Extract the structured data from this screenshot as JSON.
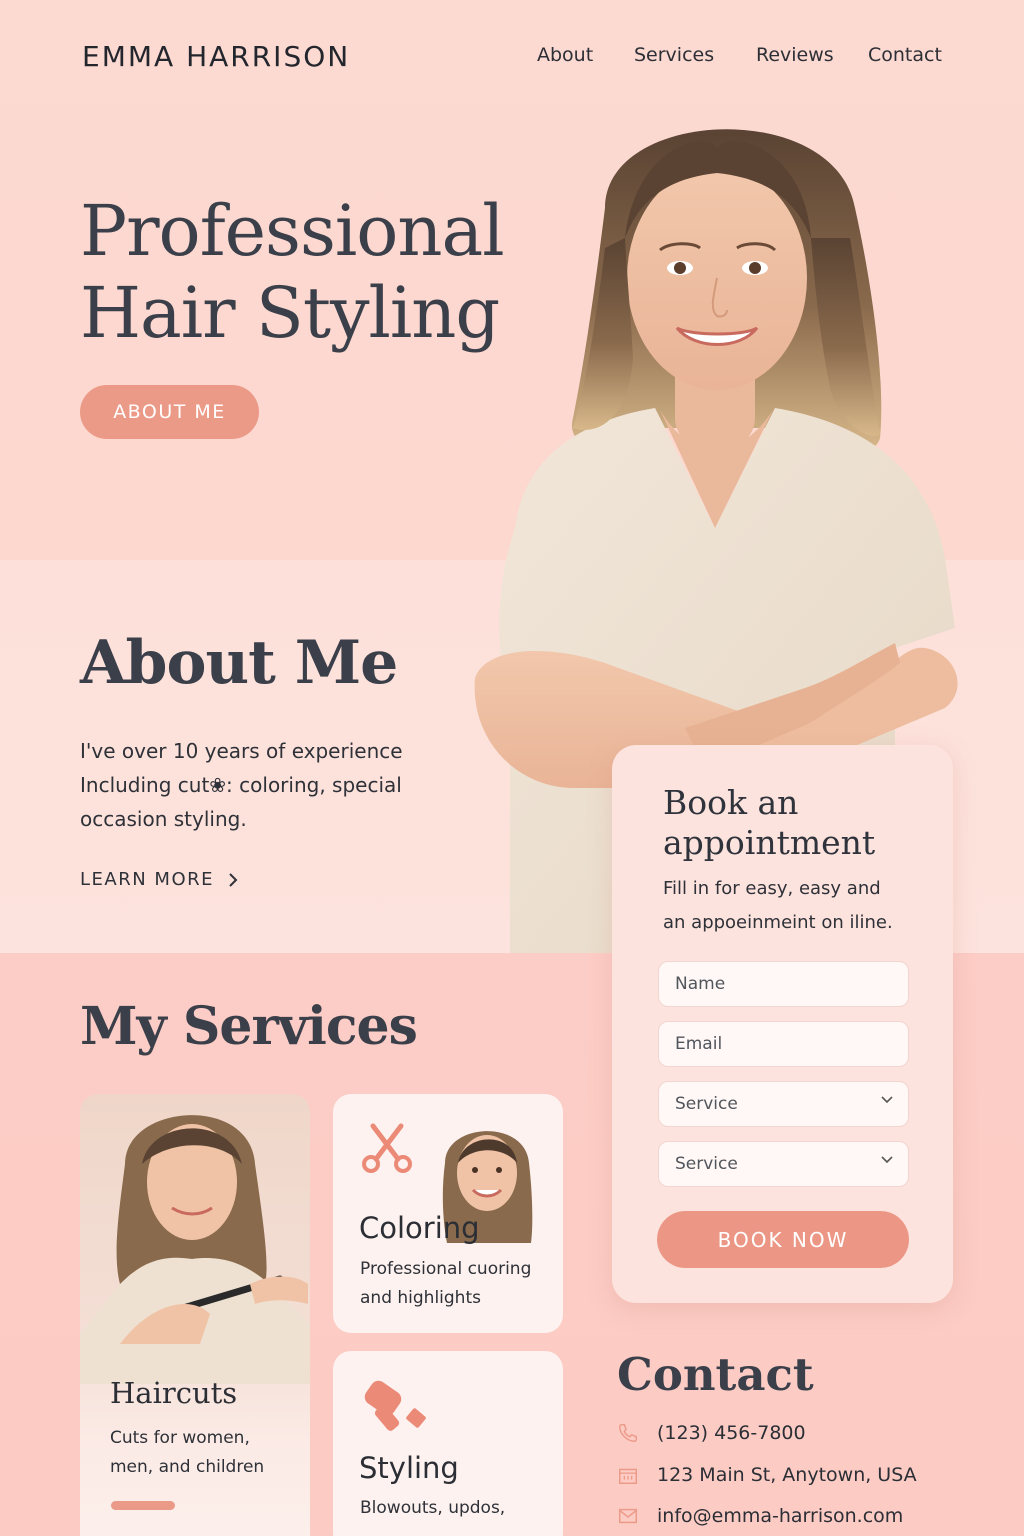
{
  "header": {
    "brand": "EMMA HARRISON",
    "nav": [
      "About",
      "Services",
      "Reviews",
      "Contact"
    ]
  },
  "hero": {
    "title_line1": "Professional",
    "title_line2": "Hair Styling",
    "button": "ABOUT ME"
  },
  "about": {
    "title": "About Me",
    "line1": "I've over 10 years of experience",
    "line2": "Including cut❀: coloring, special",
    "line3": "occasion styling.",
    "link": "LEARN MORE"
  },
  "booking": {
    "title": "Book an appointment",
    "line1": "Fill in for easy, easy and",
    "line2": "an appoeinmeint on iline.",
    "name_placeholder": "Name",
    "email_placeholder": "Email",
    "service1": "Service",
    "service2": "Service",
    "button": "BOOK NOW"
  },
  "services": {
    "title": "My Services",
    "items": [
      {
        "title": "Haircuts",
        "desc1": "Cuts for women,",
        "desc2": "men, and children",
        "icon": "photo"
      },
      {
        "title": "Coloring",
        "desc1": "Professional cuoring",
        "desc2": "and highlights",
        "icon": "scissors-icon"
      },
      {
        "title": "Styling",
        "desc1": "Blowouts, updos,",
        "desc2": "",
        "icon": "hair-dryer-icon"
      }
    ]
  },
  "contact": {
    "title": "Contact",
    "phone": "(123) 456-7800",
    "address": "123 Main St, Anytown, USA",
    "email": "info@emma-harrison.com"
  },
  "colors": {
    "accent": "#ec9a88",
    "background": "#fcd8d0",
    "text": "#3a3f4a"
  }
}
